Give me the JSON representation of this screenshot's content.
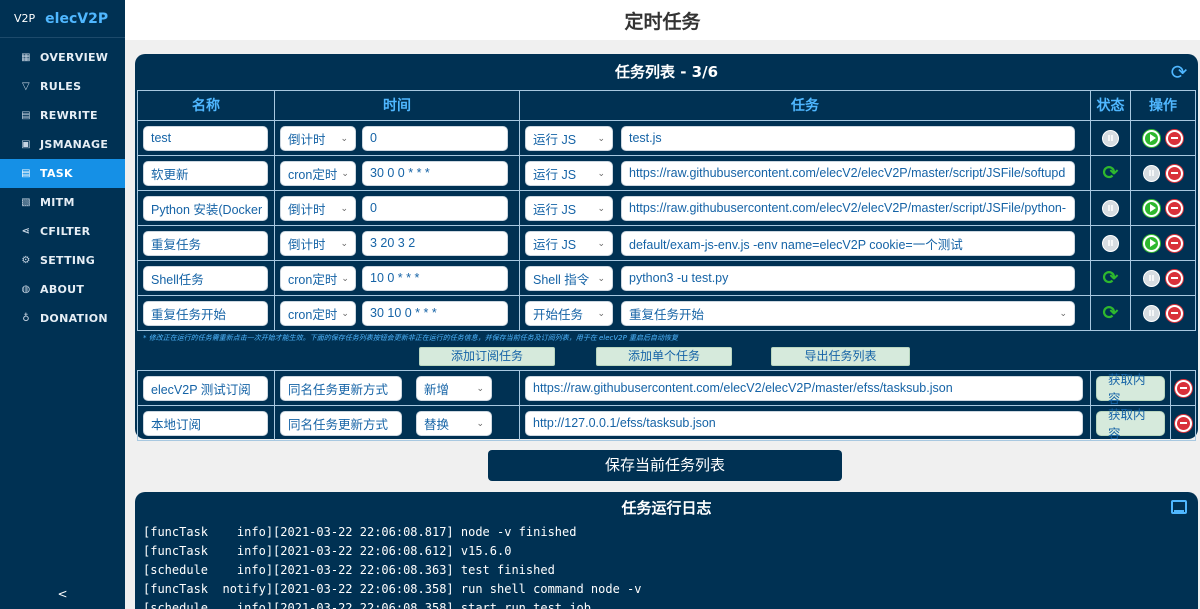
{
  "brand": {
    "logo": "V2P",
    "name": "elecV2P"
  },
  "nav": [
    {
      "icon": "▦",
      "label": "OVERVIEW"
    },
    {
      "icon": "▽",
      "label": "RULES"
    },
    {
      "icon": "▤",
      "label": "REWRITE"
    },
    {
      "icon": "▣",
      "label": "JSMANAGE"
    },
    {
      "icon": "▤",
      "label": "TASK"
    },
    {
      "icon": "▧",
      "label": "MITM"
    },
    {
      "icon": "⋖",
      "label": "CFILTER"
    },
    {
      "icon": "⚙",
      "label": "SETTING"
    },
    {
      "icon": "◍",
      "label": "ABOUT"
    },
    {
      "icon": "♁",
      "label": "DONATION"
    }
  ],
  "nav_active": "TASK",
  "collapse_label": "<",
  "page_title": "定时任务",
  "task_list": {
    "title": "任务列表 - 3/6",
    "headers": {
      "name": "名称",
      "time": "时间",
      "task": "任务",
      "status": "状态",
      "ops": "操作"
    },
    "rows": [
      {
        "name": "test",
        "time_type": "倒计时",
        "time_value": "0",
        "task_type": "运行 JS",
        "target": "test.js",
        "status": "stopped"
      },
      {
        "name": "软更新",
        "time_type": "cron定时",
        "time_value": "30 0 0 * * *",
        "task_type": "运行 JS",
        "target": "https://raw.githubusercontent.com/elecV2/elecV2P/master/script/JSFile/softupd",
        "status": "running"
      },
      {
        "name": "Python 安装(Docker",
        "time_type": "倒计时",
        "time_value": "0",
        "task_type": "运行 JS",
        "target": "https://raw.githubusercontent.com/elecV2/elecV2P/master/script/JSFile/python-",
        "status": "stopped"
      },
      {
        "name": "重复任务",
        "time_type": "倒计时",
        "time_value": "3 20 3 2",
        "task_type": "运行 JS",
        "target": "default/exam-js-env.js -env name=elecV2P cookie=一个测试",
        "status": "stopped"
      },
      {
        "name": "Shell任务",
        "time_type": "cron定时",
        "time_value": "10 0 * * *",
        "task_type": "Shell 指令",
        "target": "python3 -u test.py",
        "status": "running"
      },
      {
        "name": "重复任务开始",
        "time_type": "cron定时",
        "time_value": "30 10 0 * * *",
        "task_type": "开始任务",
        "target": "重复任务开始",
        "status": "running"
      }
    ],
    "note": "* 修改正在运行的任务需重新点击一次开始才能生效。下面的保存任务列表按钮会更新非正在运行的任务信息，并保存当前任务及订阅列表，用于在 elecV2P 重启后自动恢复",
    "buttons": {
      "add_sub": "添加订阅任务",
      "add_task": "添加单个任务",
      "export": "导出任务列表"
    },
    "subscriptions": [
      {
        "name": "elecV2P 测试订阅",
        "mode": "同名任务更新方式",
        "action": "新增",
        "url": "https://raw.githubusercontent.com/elecV2/elecV2P/master/efss/tasksub.json",
        "fetch": "获取内容"
      },
      {
        "name": "本地订阅",
        "mode": "同名任务更新方式",
        "action": "替换",
        "url": "http://127.0.0.1/efss/tasksub.json",
        "fetch": "获取内容"
      }
    ]
  },
  "save_label": "保存当前任务列表",
  "log": {
    "title": "任务运行日志",
    "lines": [
      "[funcTask    info][2021-03-22 22:06:08.817] node -v finished",
      "[funcTask    info][2021-03-22 22:06:08.612] v15.6.0",
      "[schedule    info][2021-03-22 22:06:08.363] test finished",
      "[funcTask  notify][2021-03-22 22:06:08.358] run shell command node -v",
      "[schedule    info][2021-03-22 22:06:08.358] start run test job"
    ]
  },
  "colors": {
    "navy": "#003153",
    "accent": "#4fb7ff",
    "active": "#1590e6",
    "green": "#2eb82e",
    "red": "#d9303a"
  }
}
